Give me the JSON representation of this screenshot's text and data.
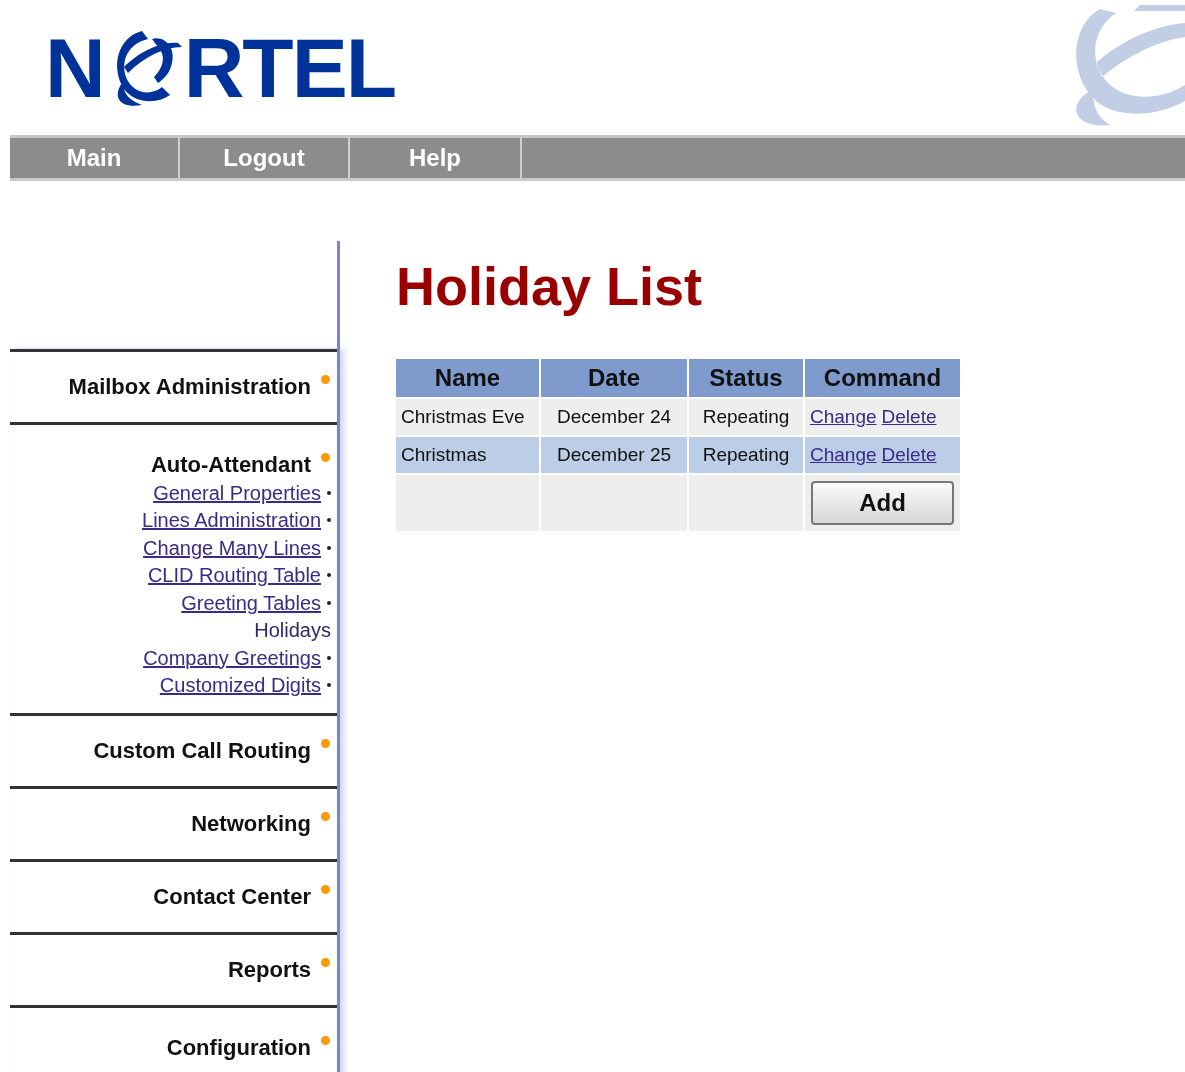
{
  "logo": {
    "before": "N",
    "after": "RTEL"
  },
  "nav": [
    {
      "label": "Main"
    },
    {
      "label": "Logout"
    },
    {
      "label": "Help"
    }
  ],
  "sidebar": [
    {
      "label": "Mailbox Administration"
    },
    {
      "label": "Auto-Attendant",
      "children": [
        {
          "label": "General Properties",
          "selected": false
        },
        {
          "label": "Lines Administration",
          "selected": false
        },
        {
          "label": "Change Many Lines",
          "selected": false
        },
        {
          "label": "CLID Routing Table",
          "selected": false
        },
        {
          "label": "Greeting Tables",
          "selected": false
        },
        {
          "label": "Holidays",
          "selected": true
        },
        {
          "label": "Company Greetings",
          "selected": false
        },
        {
          "label": "Customized Digits",
          "selected": false
        }
      ]
    },
    {
      "label": "Custom Call Routing"
    },
    {
      "label": "Networking"
    },
    {
      "label": "Contact Center"
    },
    {
      "label": "Reports"
    },
    {
      "label": "Configuration"
    }
  ],
  "heading": "Holiday List",
  "table": {
    "columns": [
      "Name",
      "Date",
      "Status",
      "Command"
    ],
    "rows": [
      {
        "name": "Christmas Eve",
        "date": "December 24",
        "status": "Repeating",
        "commands": [
          "Change",
          "Delete"
        ]
      },
      {
        "name": "Christmas",
        "date": "December 25",
        "status": "Repeating",
        "commands": [
          "Change",
          "Delete"
        ]
      }
    ],
    "add_button": "Add"
  }
}
